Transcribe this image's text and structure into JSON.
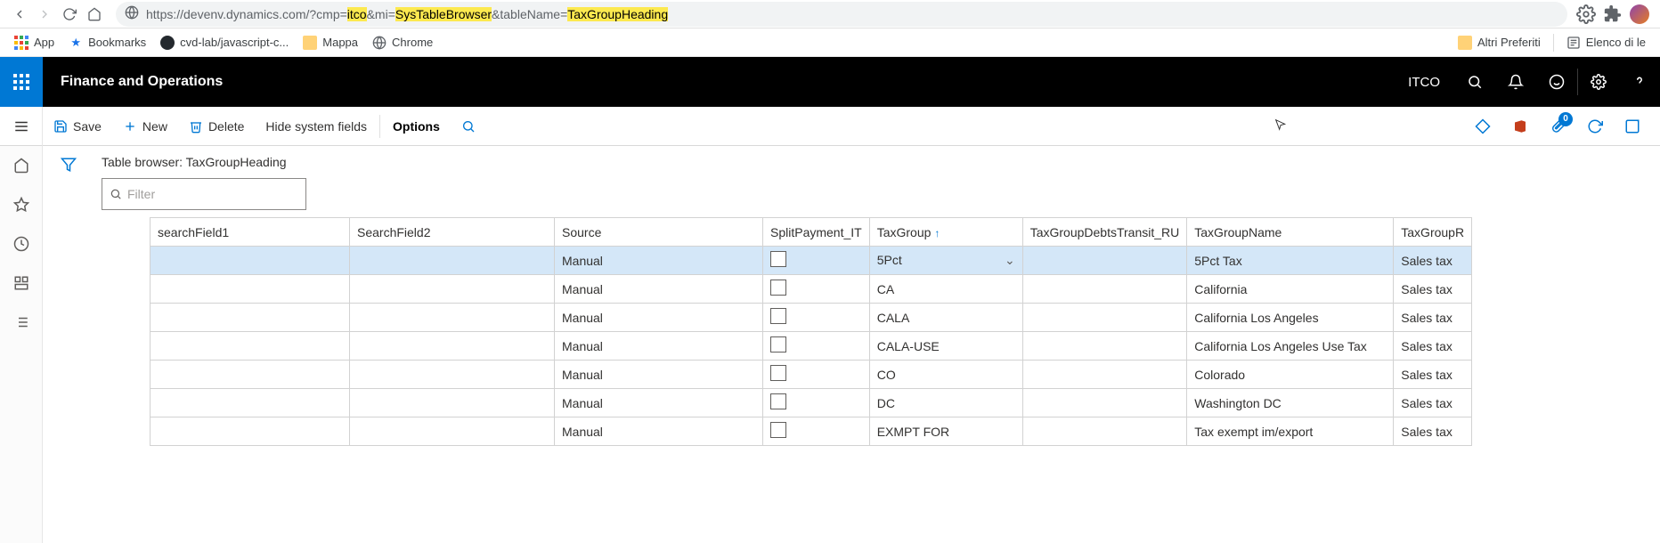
{
  "browser": {
    "url_prefix": "https://devenv.dynamics.com/?cmp=",
    "url_p1": "itco",
    "url_mid1": "&mi=",
    "url_p2": "SysTableBrowser",
    "url_mid2": "&tableName=",
    "url_p3": "TaxGroupHeading"
  },
  "bookmarks": {
    "app": "App",
    "bookmarks": "Bookmarks",
    "cvd": "cvd-lab/javascript-c...",
    "mappa": "Mappa",
    "chrome": "Chrome",
    "altri": "Altri Preferiti",
    "elenco": "Elenco di le"
  },
  "header": {
    "title": "Finance and Operations",
    "company": "ITCO"
  },
  "actions": {
    "save": "Save",
    "new": "New",
    "delete": "Delete",
    "hide": "Hide system fields",
    "options": "Options",
    "attach_count": "0"
  },
  "page": {
    "title": "Table browser: TaxGroupHeading",
    "filter_placeholder": "Filter"
  },
  "table": {
    "columns": {
      "sf1": "searchField1",
      "sf2": "SearchField2",
      "source": "Source",
      "split": "SplitPayment_IT",
      "taxgroup": "TaxGroup",
      "debts": "TaxGroupDebtsTransit_RU",
      "name": "TaxGroupName",
      "round": "TaxGroupR"
    },
    "rows": [
      {
        "source": "Manual",
        "taxgroup": "5Pct",
        "name": "5Pct Tax",
        "round": "Sales tax"
      },
      {
        "source": "Manual",
        "taxgroup": "CA",
        "name": "California",
        "round": "Sales tax"
      },
      {
        "source": "Manual",
        "taxgroup": "CALA",
        "name": "California Los Angeles",
        "round": "Sales tax"
      },
      {
        "source": "Manual",
        "taxgroup": "CALA-USE",
        "name": "California  Los Angeles Use Tax",
        "round": "Sales tax"
      },
      {
        "source": "Manual",
        "taxgroup": "CO",
        "name": "Colorado",
        "round": "Sales tax"
      },
      {
        "source": "Manual",
        "taxgroup": "DC",
        "name": "Washington DC",
        "round": "Sales tax"
      },
      {
        "source": "Manual",
        "taxgroup": "EXMPT FOR",
        "name": "Tax exempt im/export",
        "round": "Sales tax"
      }
    ]
  }
}
